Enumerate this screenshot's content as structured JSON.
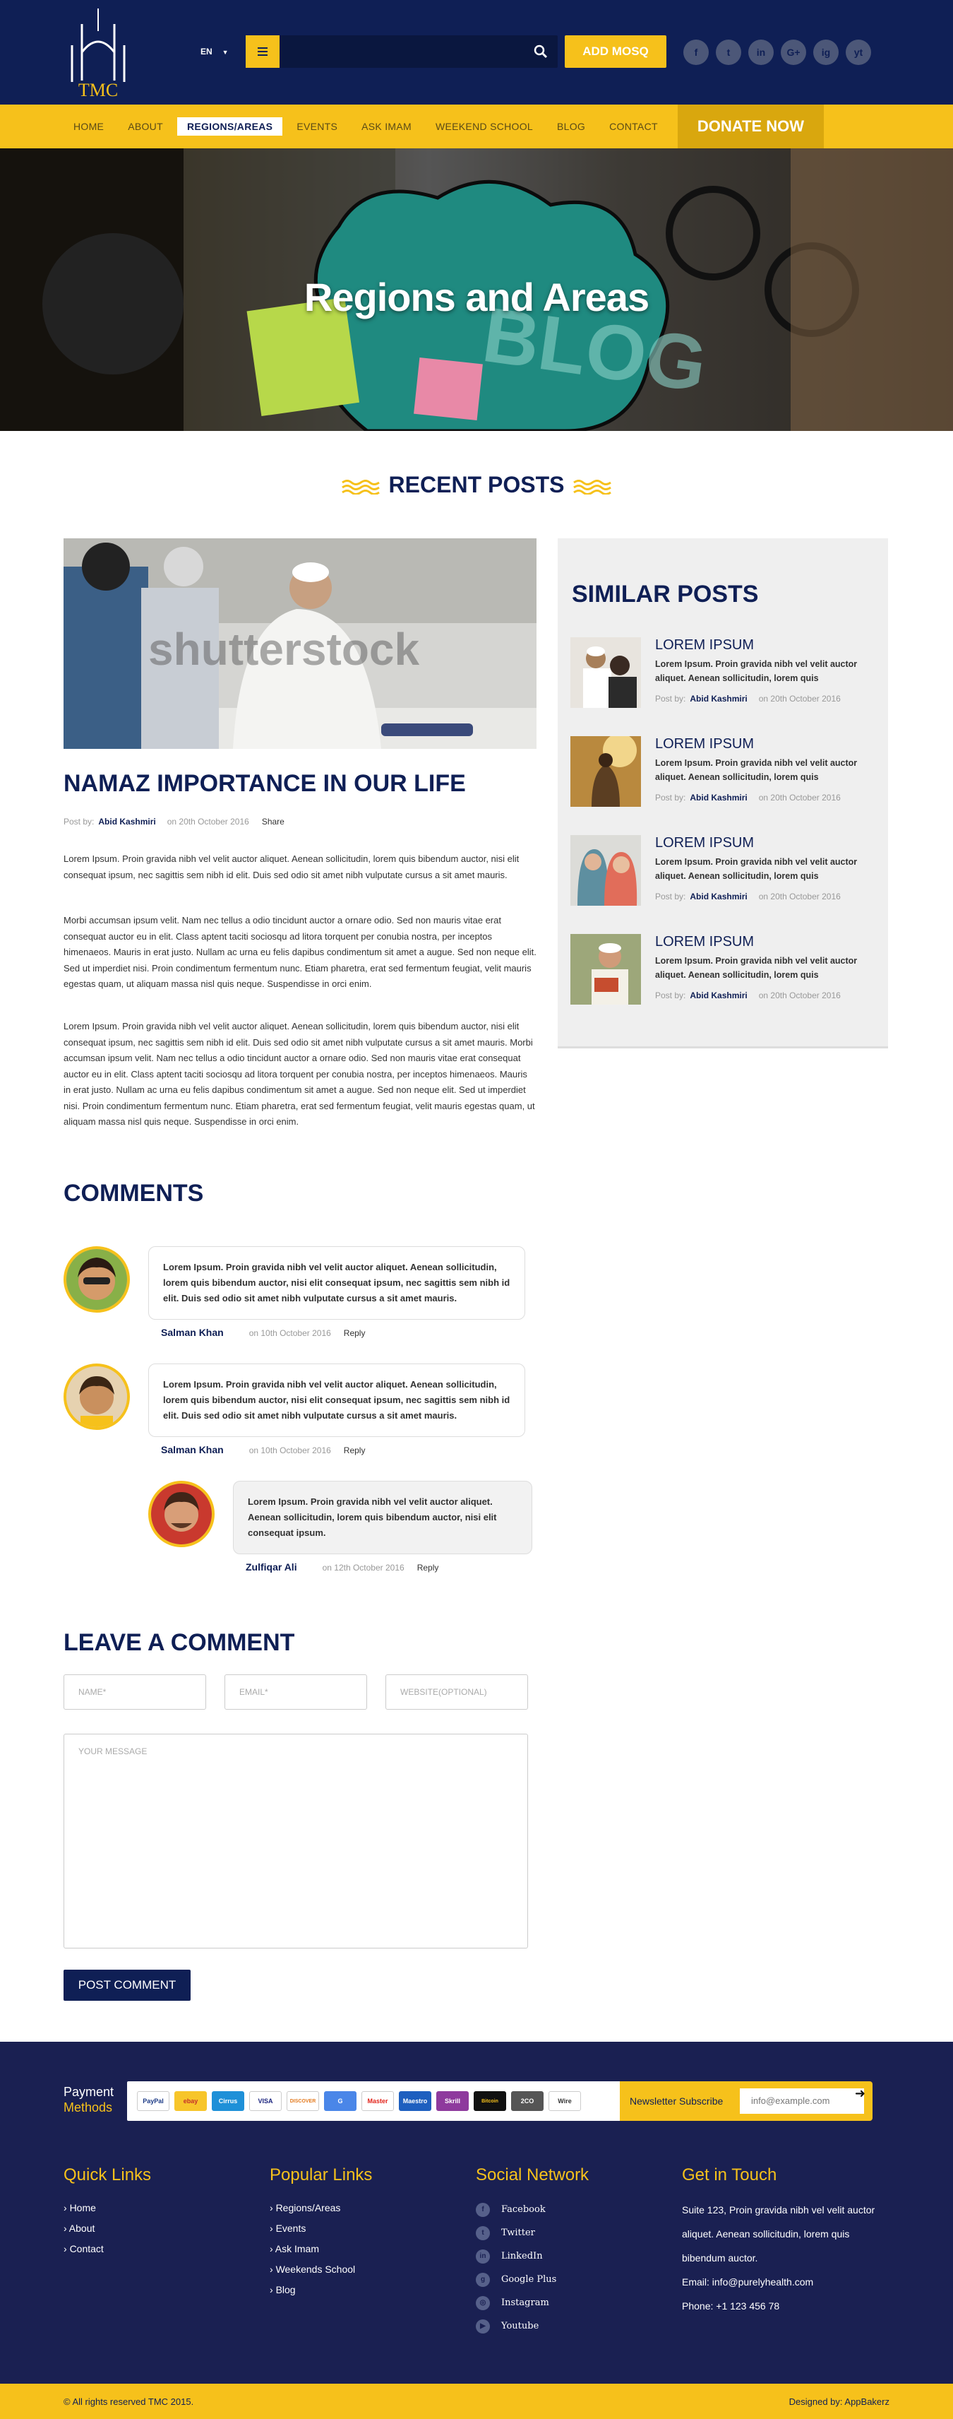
{
  "header": {
    "logo_text": "TMC",
    "lang": "EN",
    "add_button": "ADD MOSQ",
    "socials": [
      "f",
      "t",
      "in",
      "G+",
      "ig",
      "yt"
    ]
  },
  "nav": {
    "items": [
      "HOME",
      "ABOUT",
      "REGIONS/AREAS",
      "EVENTS",
      "ASK IMAM",
      "WEEKEND SCHOOL",
      "BLOG",
      "CONTACT"
    ],
    "active": "REGIONS/AREAS",
    "donate": "DONATE NOW"
  },
  "hero": {
    "title": "Regions and Areas"
  },
  "recent_title": "RECENT POSTS",
  "post": {
    "title": "NAMAZ IMPORTANCE IN OUR LIFE",
    "posted_by_label": "Post by:",
    "author": "Abid Kashmiri",
    "date": "on 20th October 2016",
    "share": "Share",
    "watermark": "shutterstock",
    "paragraphs": [
      "Lorem Ipsum. Proin gravida nibh vel velit auctor aliquet. Aenean sollicitudin, lorem quis bibendum auctor, nisi elit consequat ipsum, nec sagittis sem nibh id elit. Duis sed odio sit amet nibh vulputate cursus a sit amet mauris.",
      "Morbi accumsan ipsum velit. Nam nec tellus a odio tincidunt auctor a ornare odio. Sed non mauris vitae erat consequat auctor eu in elit. Class aptent taciti sociosqu ad litora torquent per conubia nostra, per inceptos himenaeos. Mauris in erat justo. Nullam ac urna eu felis dapibus condimentum sit amet a augue. Sed non neque elit. Sed ut imperdiet nisi. Proin condimentum fermentum nunc. Etiam pharetra, erat sed fermentum feugiat, velit mauris egestas quam, ut aliquam massa nisl quis neque. Suspendisse in orci enim.",
      "Lorem Ipsum. Proin gravida nibh vel velit auctor aliquet. Aenean sollicitudin, lorem quis bibendum auctor, nisi elit consequat ipsum, nec sagittis sem nibh id elit. Duis sed odio sit amet nibh vulputate cursus a sit amet mauris. Morbi accumsan ipsum velit. Nam nec tellus a odio tincidunt auctor a ornare odio. Sed non mauris vitae erat consequat auctor eu in elit. Class aptent taciti sociosqu ad litora torquent per conubia nostra, per inceptos himenaeos. Mauris in erat justo. Nullam ac urna eu felis dapibus condimentum sit amet a augue. Sed non neque elit. Sed ut imperdiet nisi. Proin condimentum fermentum nunc. Etiam pharetra, erat sed fermentum feugiat, velit mauris egestas quam, ut aliquam massa nisl quis neque. Suspendisse in orci enim."
    ]
  },
  "similar": {
    "title": "SIMILAR POSTS",
    "items": [
      {
        "title": "LOREM IPSUM",
        "text": "Lorem Ipsum. Proin gravida nibh vel velit auctor aliquet. Aenean sollicitudin, lorem quis",
        "by": "Post by:",
        "author": "Abid Kashmiri",
        "date": "on 20th October 2016"
      },
      {
        "title": "LOREM IPSUM",
        "text": "Lorem Ipsum. Proin gravida nibh vel velit auctor aliquet. Aenean sollicitudin, lorem quis",
        "by": "Post by:",
        "author": "Abid Kashmiri",
        "date": "on 20th October 2016"
      },
      {
        "title": "LOREM IPSUM",
        "text": "Lorem Ipsum. Proin gravida nibh vel velit auctor aliquet. Aenean sollicitudin, lorem quis",
        "by": "Post by:",
        "author": "Abid Kashmiri",
        "date": "on 20th October 2016"
      },
      {
        "title": "LOREM IPSUM",
        "text": "Lorem Ipsum. Proin gravida nibh vel velit auctor aliquet. Aenean sollicitudin, lorem quis",
        "by": "Post by:",
        "author": "Abid Kashmiri",
        "date": "on 20th October 2016"
      }
    ]
  },
  "comments": {
    "title": "COMMENTS",
    "items": [
      {
        "text": "Lorem Ipsum. Proin gravida nibh vel velit auctor aliquet. Aenean sollicitudin, lorem quis bibendum auctor, nisi elit consequat ipsum, nec sagittis sem nibh id elit. Duis sed odio sit amet nibh vulputate cursus a sit amet mauris.",
        "name": "Salman Khan",
        "date": "on 10th October 2016",
        "reply": "Reply"
      },
      {
        "text": "Lorem Ipsum. Proin gravida nibh vel velit auctor aliquet. Aenean sollicitudin, lorem quis bibendum auctor, nisi elit consequat ipsum, nec sagittis sem nibh id elit. Duis sed odio sit amet nibh vulputate cursus a sit amet mauris.",
        "name": "Salman Khan",
        "date": "on 10th October 2016",
        "reply": "Reply"
      },
      {
        "text": "Lorem Ipsum. Proin gravida nibh vel velit auctor aliquet. Aenean sollicitudin, lorem quis bibendum auctor, nisi elit consequat ipsum.",
        "name": "Zulfiqar Ali",
        "date": "on 12th October 2016",
        "reply": "Reply"
      }
    ]
  },
  "form": {
    "title": "LEAVE A COMMENT",
    "name_ph": "NAME*",
    "email_ph": "EMAIL*",
    "website_ph": "WEBSITE(OPTIONAL)",
    "message_ph": "YOUR MESSAGE",
    "submit": "POST COMMENT"
  },
  "footer": {
    "payment_label_1": "Payment",
    "payment_label_2": "Methods",
    "cards": [
      "PayPal",
      "ebay",
      "Cirrus",
      "VISA",
      "DISCOVER",
      "G",
      "Master",
      "Maestro",
      "Skrill",
      "Bitcoin",
      "2CO",
      "Wire"
    ],
    "newsletter_label": "Newsletter Subscribe",
    "newsletter_placeholder": "info@example.com",
    "quick_title": "Quick Links",
    "quick": [
      "Home",
      "About",
      "Contact"
    ],
    "popular_title": "Popular Links",
    "popular": [
      "Regions/Areas",
      "Events",
      "Ask Imam",
      "Weekends School",
      "Blog"
    ],
    "social_title": "Social Network",
    "social": [
      "Facebook",
      "Twitter",
      "LinkedIn",
      "Google Plus",
      "Instagram",
      "Youtube"
    ],
    "touch_title": "Get in Touch",
    "address": "Suite 123, Proin gravida nibh vel velit auctor aliquet. Aenean sollicitudin, lorem quis bibendum auctor.",
    "email": "Email: info@purelyhealth.com",
    "phone": "Phone: +1 123 456 78",
    "copyright": "© All rights reserved TMC 2015.",
    "designed": "Designed by: AppBakerz"
  },
  "colors": {
    "navy": "#0f1f55",
    "gold": "#f6c11b"
  }
}
